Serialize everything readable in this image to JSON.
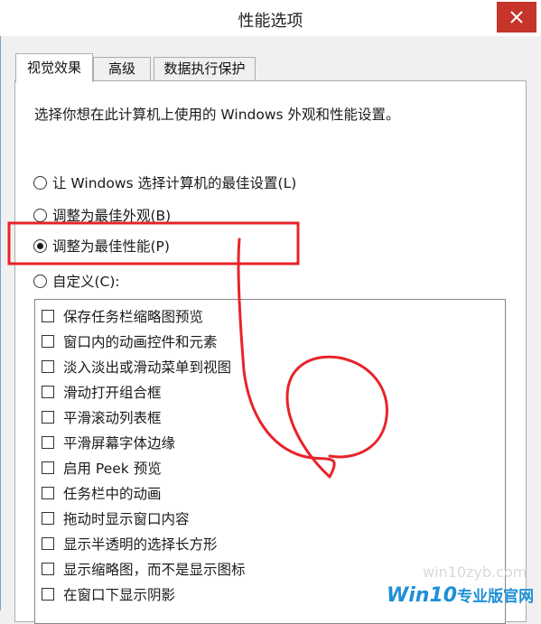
{
  "window": {
    "title": "性能选项",
    "close_icon": "close-icon"
  },
  "tabs": [
    {
      "label": "视觉效果",
      "active": true
    },
    {
      "label": "高级",
      "active": false
    },
    {
      "label": "数据执行保护",
      "active": false
    }
  ],
  "visual_effects": {
    "description": "选择你想在此计算机上使用的 Windows 外观和性能设置。",
    "options": [
      {
        "label": "让 Windows 选择计算机的最佳设置(L)",
        "checked": false
      },
      {
        "label": "调整为最佳外观(B)",
        "checked": false
      },
      {
        "label": "调整为最佳性能(P)",
        "checked": true
      },
      {
        "label": "自定义(C):",
        "checked": false
      }
    ],
    "custom_items": [
      {
        "label": "保存任务栏缩略图预览",
        "checked": false
      },
      {
        "label": "窗口内的动画控件和元素",
        "checked": false
      },
      {
        "label": "淡入淡出或滑动菜单到视图",
        "checked": false
      },
      {
        "label": "滑动打开组合框",
        "checked": false
      },
      {
        "label": "平滑滚动列表框",
        "checked": false
      },
      {
        "label": "平滑屏幕字体边缘",
        "checked": false
      },
      {
        "label": "启用 Peek 预览",
        "checked": false
      },
      {
        "label": "任务栏中的动画",
        "checked": false
      },
      {
        "label": "拖动时显示窗口内容",
        "checked": false
      },
      {
        "label": "显示半透明的选择长方形",
        "checked": false
      },
      {
        "label": "显示缩略图，而不是显示图标",
        "checked": false
      },
      {
        "label": "在窗口下显示阴影",
        "checked": false
      }
    ]
  },
  "annotation": {
    "color": "#e8232a"
  },
  "watermark": {
    "url": "win10zyb.com",
    "logo_main": "Win10",
    "logo_sub": "专业版官网"
  }
}
